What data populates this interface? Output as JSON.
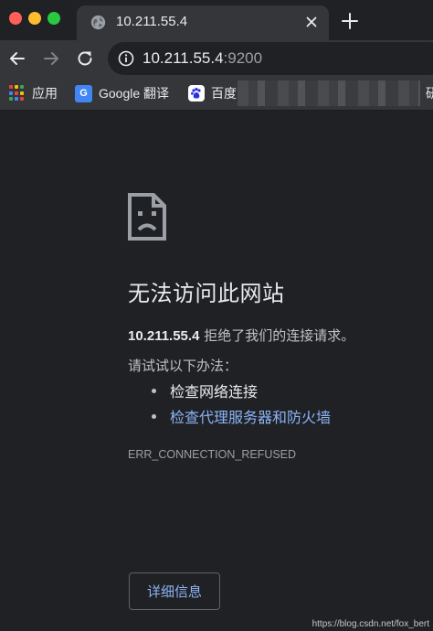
{
  "window": {
    "traffic_lights": {
      "close": "#ff5f57",
      "minimize": "#febc2e",
      "maximize": "#28c840"
    }
  },
  "tab": {
    "title": "10.211.55.4",
    "favicon": "globe-icon"
  },
  "omnibox": {
    "host": "10.211.55.4",
    "port": ":9200"
  },
  "bookmarks": {
    "apps_label": "应用",
    "google_label": "Google 翻译",
    "baidu_label": "百度",
    "trailing_label": "研"
  },
  "error_page": {
    "title": "无法访问此网站",
    "host": "10.211.55.4",
    "description": " 拒绝了我们的连接请求。",
    "try_label": "请试试以下办法：",
    "suggestions": [
      "检查网络连接",
      "检查代理服务器和防火墙"
    ],
    "error_code": "ERR_CONNECTION_REFUSED",
    "details_button": "详细信息"
  },
  "watermark": "https://blog.csdn.net/fox_bert",
  "colors": {
    "page_bg": "#202124",
    "toolbar_bg": "#35363a",
    "text_primary": "#e8eaed",
    "text_secondary": "#bdc1c6",
    "link": "#8ab4f8"
  }
}
